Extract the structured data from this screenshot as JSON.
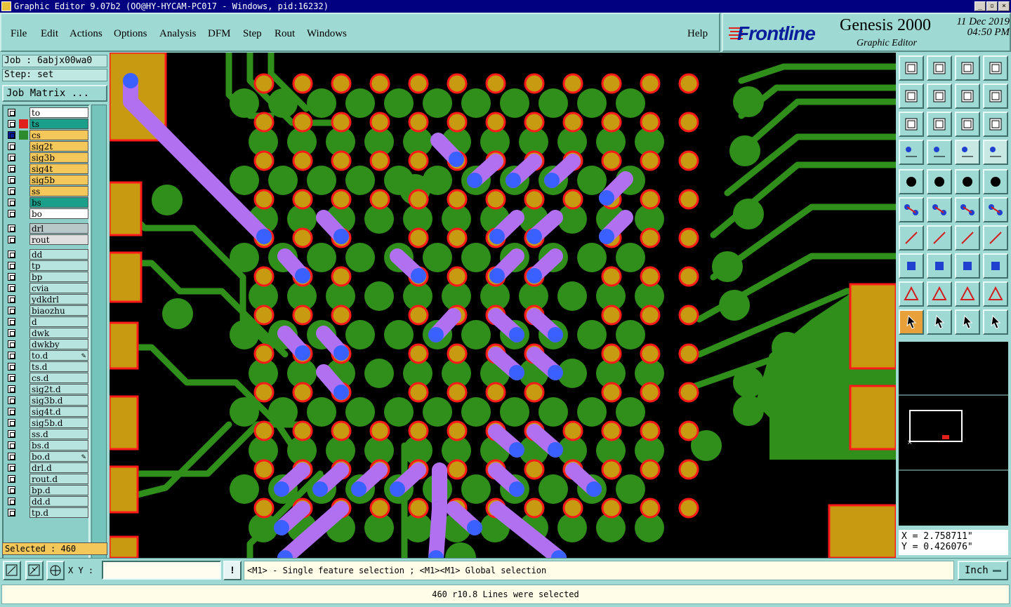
{
  "window": {
    "title": "Graphic Editor 9.07b2 (OO@HY-HYCAM-PC017 - Windows, pid:16232)"
  },
  "menu": {
    "file": "File",
    "edit": "Edit",
    "actions": "Actions",
    "options": "Options",
    "analysis": "Analysis",
    "dfm": "DFM",
    "step": "Step",
    "rout": "Rout",
    "windows": "Windows",
    "help": "Help"
  },
  "brand": {
    "logo": "Frontline",
    "product": "Genesis 2000",
    "subtitle": "Graphic Editor",
    "date_line1": "11 Dec 2019",
    "date_line2": "04:50 PM"
  },
  "job": {
    "job_label": "Job : 6abjx00wa0",
    "step_label": "Step: set",
    "matrix_button": "Job Matrix ..."
  },
  "layers": [
    {
      "name": "to",
      "color": "#ffffff",
      "swatch": "",
      "active": false
    },
    {
      "name": "ts",
      "color": "#1aa08a",
      "swatch": "#e0201a",
      "active": false
    },
    {
      "name": "cs",
      "color": "#f3c75a",
      "swatch": "#2d8a2d",
      "active": true
    },
    {
      "name": "sig2t",
      "color": "#f3c75a",
      "swatch": "",
      "active": false
    },
    {
      "name": "sig3b",
      "color": "#f3c75a",
      "swatch": "",
      "active": false
    },
    {
      "name": "sig4t",
      "color": "#f3c75a",
      "swatch": "",
      "active": false
    },
    {
      "name": "sig5b",
      "color": "#f3c75a",
      "swatch": "",
      "active": false
    },
    {
      "name": "ss",
      "color": "#f3c75a",
      "swatch": "",
      "active": false
    },
    {
      "name": "bs",
      "color": "#1aa08a",
      "swatch": "",
      "active": false
    },
    {
      "name": "bo",
      "color": "#ffffff",
      "swatch": "",
      "active": false
    },
    {
      "name": "drl",
      "color": "#b8c8c8",
      "swatch": "",
      "active": false
    },
    {
      "name": "rout",
      "color": "#e0e0e0",
      "swatch": "",
      "active": false
    },
    {
      "name": "dd",
      "color": "#b8e4e0",
      "swatch": "",
      "active": false
    },
    {
      "name": "tp",
      "color": "#b8e4e0",
      "swatch": "",
      "active": false
    },
    {
      "name": "bp",
      "color": "#b8e4e0",
      "swatch": "",
      "active": false
    },
    {
      "name": "cvia",
      "color": "#b8e4e0",
      "swatch": "",
      "active": false
    },
    {
      "name": "ydkdrl",
      "color": "#b8e4e0",
      "swatch": "",
      "active": false
    },
    {
      "name": "biaozhu",
      "color": "#b8e4e0",
      "swatch": "",
      "active": false
    },
    {
      "name": "d",
      "color": "#b8e4e0",
      "swatch": "",
      "active": false
    },
    {
      "name": "dwk",
      "color": "#b8e4e0",
      "swatch": "",
      "active": false
    },
    {
      "name": "dwkby",
      "color": "#b8e4e0",
      "swatch": "",
      "active": false
    },
    {
      "name": "to.d",
      "color": "#b8e4e0",
      "swatch": "",
      "active": false,
      "edited": true
    },
    {
      "name": "ts.d",
      "color": "#b8e4e0",
      "swatch": "",
      "active": false
    },
    {
      "name": "cs.d",
      "color": "#b8e4e0",
      "swatch": "",
      "active": false
    },
    {
      "name": "sig2t.d",
      "color": "#b8e4e0",
      "swatch": "",
      "active": false
    },
    {
      "name": "sig3b.d",
      "color": "#b8e4e0",
      "swatch": "",
      "active": false
    },
    {
      "name": "sig4t.d",
      "color": "#b8e4e0",
      "swatch": "",
      "active": false
    },
    {
      "name": "sig5b.d",
      "color": "#b8e4e0",
      "swatch": "",
      "active": false
    },
    {
      "name": "ss.d",
      "color": "#b8e4e0",
      "swatch": "",
      "active": false
    },
    {
      "name": "bs.d",
      "color": "#b8e4e0",
      "swatch": "",
      "active": false
    },
    {
      "name": "bo.d",
      "color": "#b8e4e0",
      "swatch": "",
      "active": false,
      "edited": true
    },
    {
      "name": "drl.d",
      "color": "#b8e4e0",
      "swatch": "",
      "active": false
    },
    {
      "name": "rout.d",
      "color": "#b8e4e0",
      "swatch": "",
      "active": false
    },
    {
      "name": "bp.d",
      "color": "#b8e4e0",
      "swatch": "",
      "active": false
    },
    {
      "name": "dd.d",
      "color": "#b8e4e0",
      "swatch": "",
      "active": false
    },
    {
      "name": "tp.d",
      "color": "#b8e4e0",
      "swatch": "",
      "active": false
    }
  ],
  "selected_label": "Selected : 460",
  "coords": {
    "x": "X = 2.758711\"",
    "y": "Y = 0.426076\""
  },
  "command": {
    "xy_label": "X Y :",
    "xy_value": "",
    "warn_glyph": "!",
    "prompt": "<M1> - Single feature selection ; <M1><M1> Global selection",
    "units": "Inch"
  },
  "status": "460 r10.8 Lines were selected",
  "colors": {
    "copper": "#2f8f1a",
    "pad_fill": "#c89a12",
    "pad_ring": "#ff1a1a",
    "selected": "#b070f0",
    "via_select": "#3a60ff"
  }
}
